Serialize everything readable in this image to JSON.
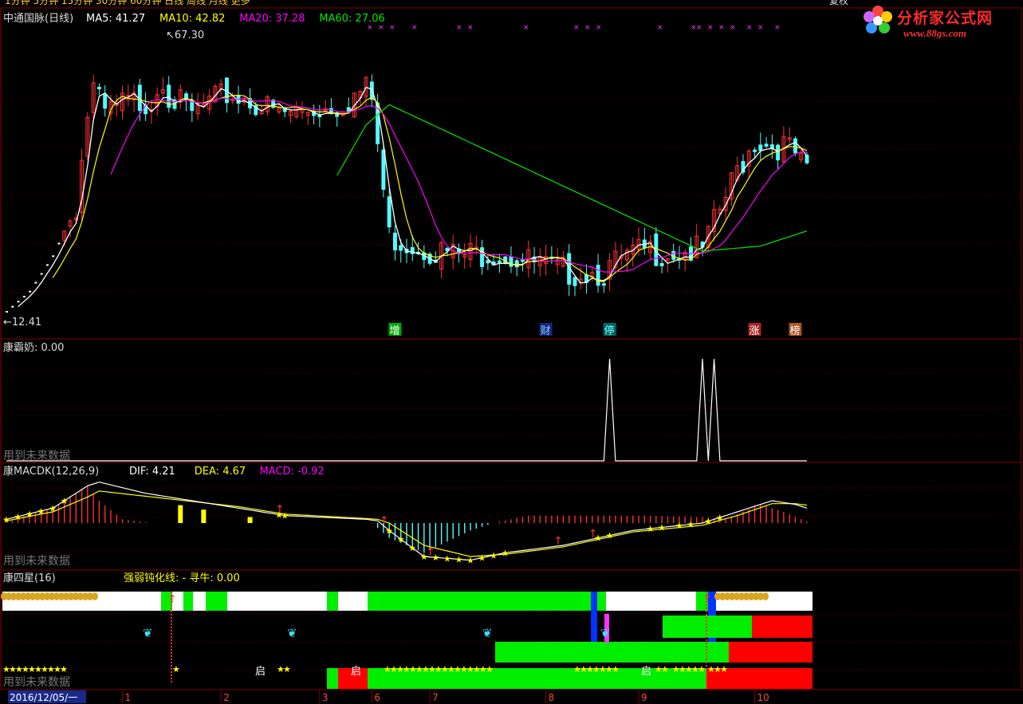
{
  "top_menu": {
    "left_text": "1分钟 5分钟 15分钟 30分钟 60分钟 日线 周线 月线 更多",
    "right_text": "复权"
  },
  "watermark": {
    "title": "分析家公式网",
    "url": "www.88gs.com"
  },
  "colors": {
    "up": "#ff3232",
    "down": "#54fcfc",
    "ma5": "#ffffff",
    "ma10": "#ffff00",
    "ma20": "#ff00ff",
    "ma60": "#00e600",
    "grid": "#880000",
    "star": "#ffff00"
  },
  "chart_data": [
    {
      "type": "candlestick",
      "title": "中通国脉(日线)",
      "indicators": [
        {
          "name": "MA5",
          "value": "41.27",
          "color": "#ffffff"
        },
        {
          "name": "MA10",
          "value": "42.82",
          "color": "#ffff00"
        },
        {
          "name": "MA20",
          "value": "37.28",
          "color": "#ff00ff"
        },
        {
          "name": "MA60",
          "value": "27.06",
          "color": "#00e600"
        }
      ],
      "high_annotation": "67.30",
      "low_annotation": "12.41",
      "ylim": [
        10,
        70
      ],
      "gap_start": 79,
      "n_bars": 139,
      "events": [
        {
          "label": "增",
          "at": 67
        },
        {
          "label": "财",
          "at": 93
        },
        {
          "label": "停",
          "at": 104
        },
        {
          "label": "涨",
          "at": 129
        },
        {
          "label": "榜",
          "at": 136
        }
      ],
      "key_closes": [
        [
          0,
          13
        ],
        [
          4,
          17
        ],
        [
          8,
          24
        ],
        [
          12,
          34
        ],
        [
          14,
          52
        ],
        [
          15,
          57
        ],
        [
          17,
          52
        ],
        [
          20,
          54
        ],
        [
          25,
          55
        ],
        [
          27,
          60
        ],
        [
          28,
          56
        ],
        [
          32,
          52
        ],
        [
          38,
          56
        ],
        [
          42,
          55
        ],
        [
          47,
          52
        ],
        [
          52,
          53
        ],
        [
          57,
          54
        ],
        [
          62,
          57
        ],
        [
          63,
          55
        ],
        [
          66,
          28
        ],
        [
          68,
          27
        ],
        [
          78,
          24
        ],
        [
          84,
          25
        ],
        [
          95,
          21
        ],
        [
          103,
          21
        ],
        [
          106,
          23
        ],
        [
          110,
          25
        ],
        [
          120,
          25
        ],
        [
          123,
          33
        ],
        [
          126,
          41
        ],
        [
          129,
          47
        ],
        [
          132,
          46
        ],
        [
          134,
          46
        ],
        [
          136,
          44
        ],
        [
          138,
          40
        ]
      ]
    },
    {
      "type": "line",
      "title": "康霸奶",
      "value_text": ": 0.00",
      "ylim": [
        0,
        1
      ],
      "spikes": [
        104,
        120,
        122
      ]
    },
    {
      "type": "histogram",
      "title": "康MACDK(12,26,9)",
      "indicators": [
        {
          "name": "DIF",
          "value": "4.21",
          "color": "#ffffff"
        },
        {
          "name": "DEA",
          "value": "4.67",
          "color": "#ffff00"
        },
        {
          "name": "MACD",
          "value": "-0.92",
          "color": "#ff00ff"
        }
      ],
      "ylim": [
        -6,
        6
      ],
      "macd_keys": [
        [
          0,
          0.3
        ],
        [
          8,
          2
        ],
        [
          12,
          4
        ],
        [
          14,
          5
        ],
        [
          16,
          3
        ],
        [
          20,
          0.5
        ],
        [
          25,
          0
        ],
        [
          40,
          0
        ],
        [
          63,
          0
        ],
        [
          66,
          -2
        ],
        [
          72,
          -4
        ],
        [
          80,
          -1
        ],
        [
          84,
          0
        ],
        [
          90,
          1
        ],
        [
          110,
          1
        ],
        [
          120,
          0.8
        ],
        [
          124,
          0.5
        ],
        [
          126,
          1.2
        ],
        [
          130,
          2.5
        ],
        [
          134,
          1.5
        ],
        [
          138,
          0.2
        ]
      ],
      "dif_keys": [
        [
          0,
          0.5
        ],
        [
          8,
          2
        ],
        [
          14,
          5
        ],
        [
          16,
          5.5
        ],
        [
          24,
          4
        ],
        [
          40,
          2
        ],
        [
          48,
          1
        ],
        [
          62,
          0.5
        ],
        [
          64,
          0.3
        ],
        [
          66,
          -1
        ],
        [
          72,
          -4.5
        ],
        [
          80,
          -5
        ],
        [
          86,
          -4
        ],
        [
          96,
          -3
        ],
        [
          108,
          -1
        ],
        [
          120,
          0
        ],
        [
          126,
          1.5
        ],
        [
          132,
          3
        ],
        [
          136,
          2.5
        ],
        [
          138,
          2
        ]
      ],
      "dea_keys": [
        [
          0,
          0.3
        ],
        [
          8,
          1.5
        ],
        [
          14,
          3.5
        ],
        [
          16,
          4.3
        ],
        [
          24,
          3.6
        ],
        [
          40,
          2.2
        ],
        [
          48,
          1.2
        ],
        [
          62,
          0.6
        ],
        [
          64,
          0.5
        ],
        [
          66,
          0
        ],
        [
          72,
          -3
        ],
        [
          80,
          -4.5
        ],
        [
          86,
          -4.2
        ],
        [
          96,
          -3.2
        ],
        [
          108,
          -1.2
        ],
        [
          120,
          -0.3
        ],
        [
          126,
          1
        ],
        [
          132,
          2.6
        ],
        [
          136,
          2.6
        ],
        [
          138,
          2.4
        ]
      ]
    },
    {
      "type": "bars",
      "title": "康四星",
      "param": "(16)",
      "sub_label": "强弱钝化线: -  寻牛: 0.00",
      "markers": [
        "启",
        "启",
        "启"
      ]
    }
  ],
  "footer_note": "用到未来数据",
  "time_axis": {
    "start_label": "2016/12/05/一",
    "tick_labels": [
      {
        "label": "1",
        "at": 20
      },
      {
        "label": "2",
        "at": 37
      },
      {
        "label": "3",
        "at": 54
      },
      {
        "label": "6",
        "at": 63
      },
      {
        "label": "7",
        "at": 73
      },
      {
        "label": "8",
        "at": 93
      },
      {
        "label": "9",
        "at": 109
      },
      {
        "label": "10",
        "at": 129
      }
    ]
  }
}
